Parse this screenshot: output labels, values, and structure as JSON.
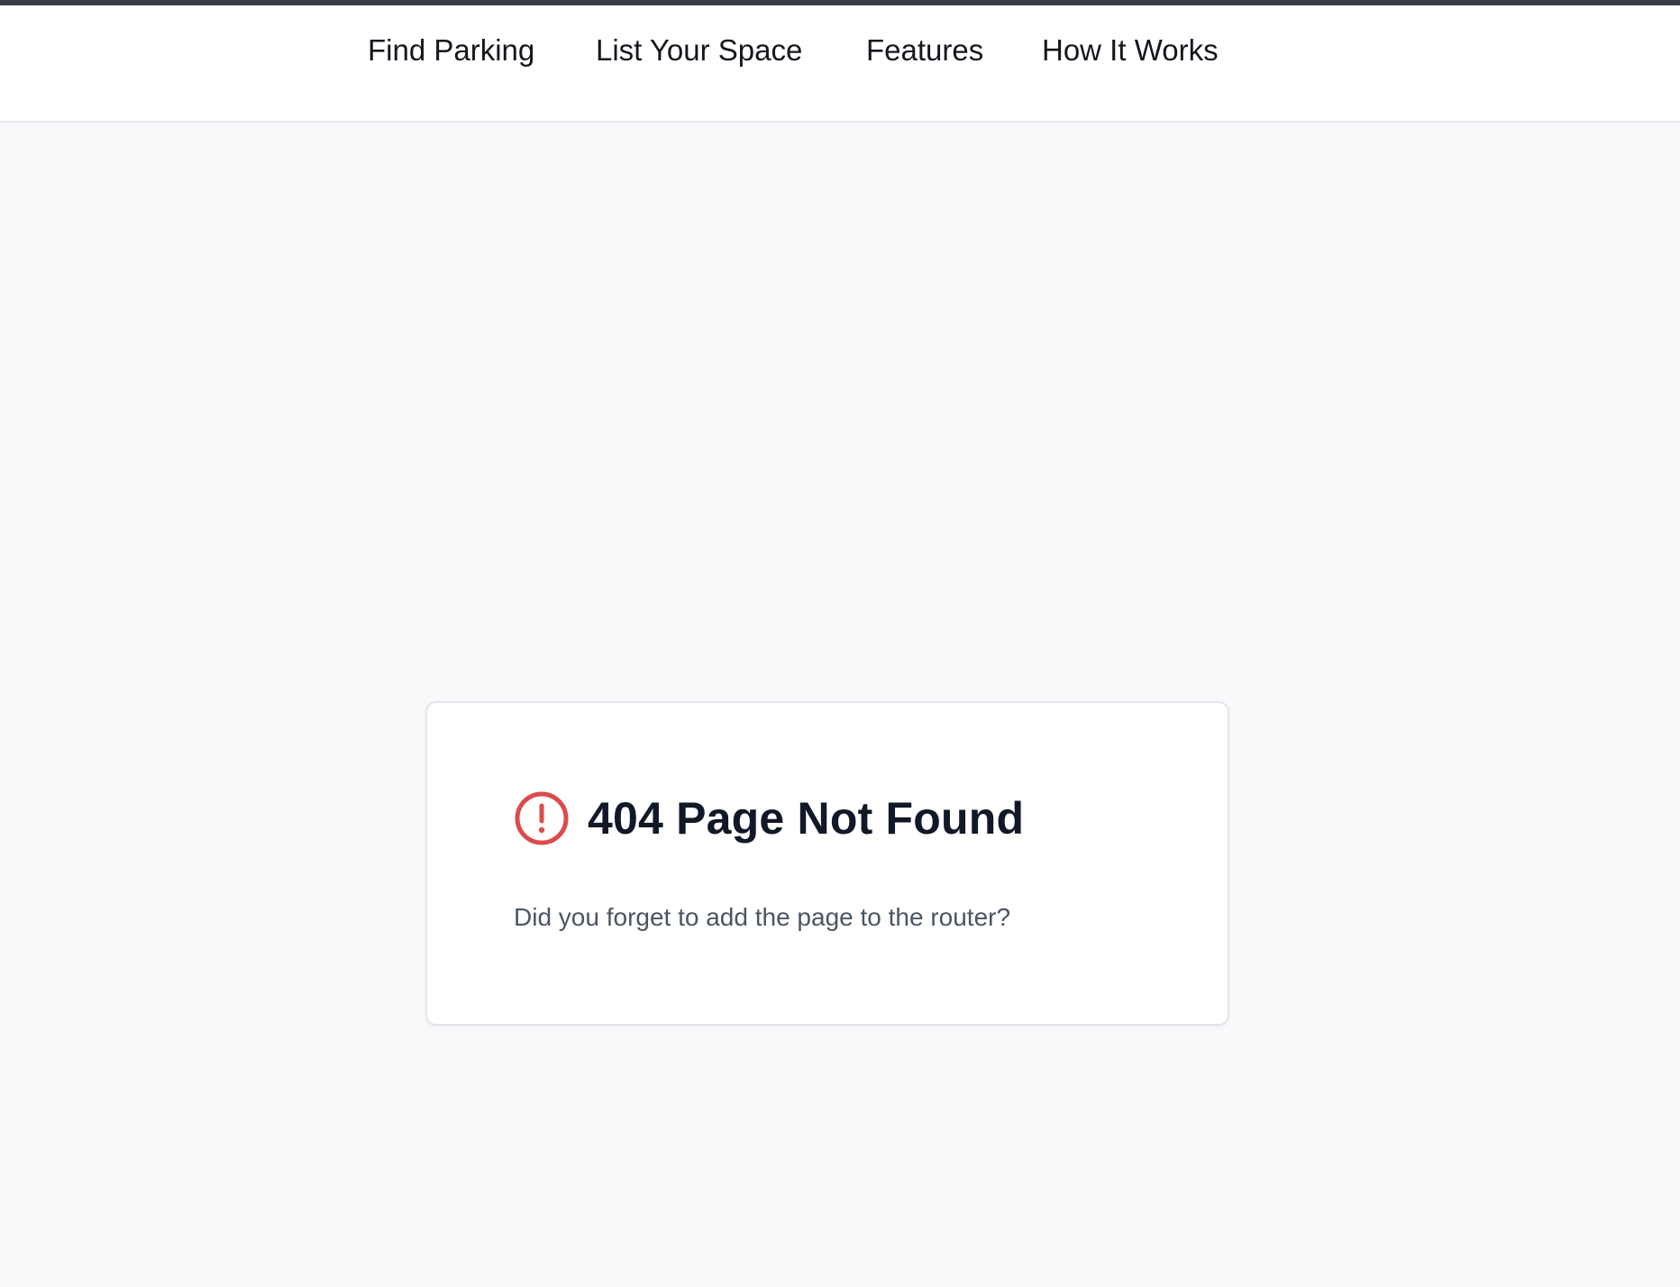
{
  "nav": {
    "items": [
      {
        "label": "Find Parking"
      },
      {
        "label": "List Your Space"
      },
      {
        "label": "Features"
      },
      {
        "label": "How It Works"
      }
    ]
  },
  "error_card": {
    "icon": "alert-circle-icon",
    "icon_color": "#dc4b4b",
    "title": "404 Page Not Found",
    "message": "Did you forget to add the page to the router?"
  },
  "colors": {
    "top_strip": "#383a45",
    "background": "#f8f9fb",
    "header_background": "#ffffff",
    "title_text": "#111827",
    "message_text": "#4b5563"
  }
}
